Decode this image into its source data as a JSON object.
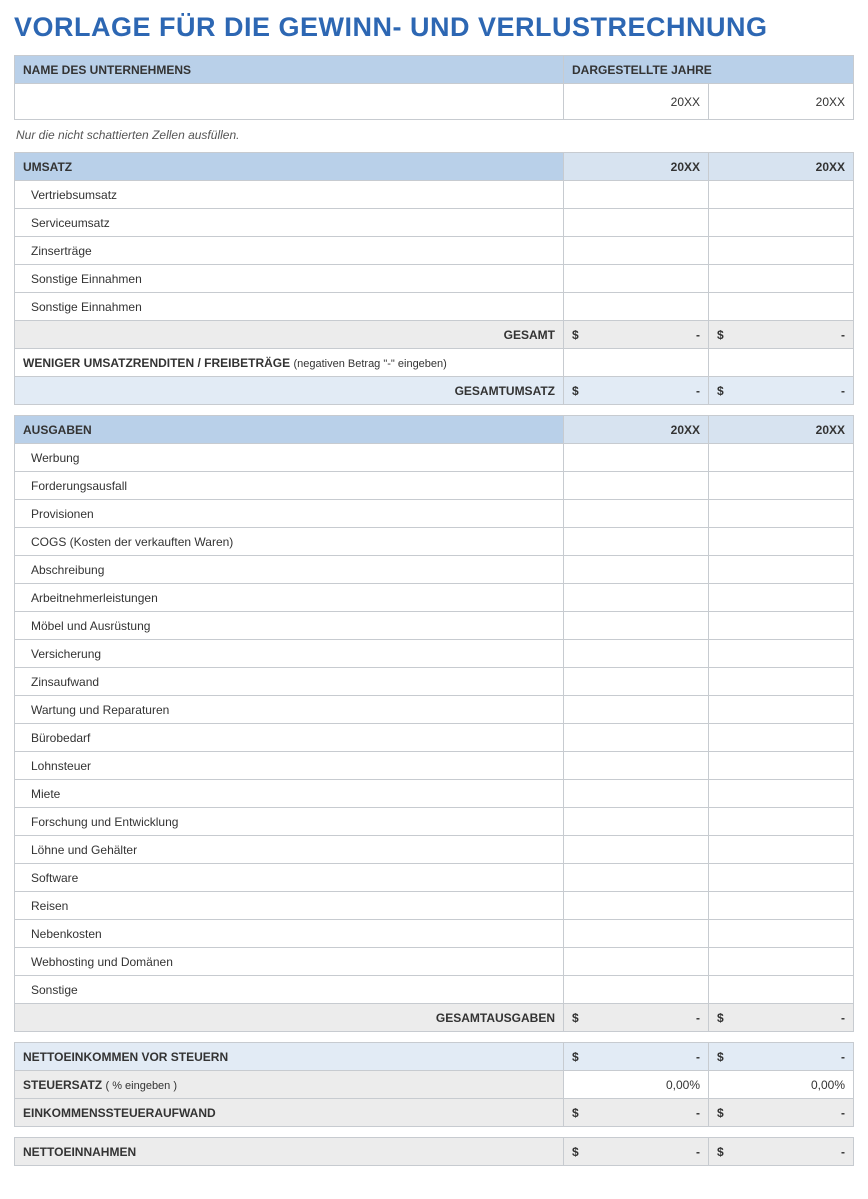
{
  "title": "VORLAGE FÜR DIE GEWINN- UND VERLUSTRECHNUNG",
  "company_header": {
    "name_label": "NAME DES UNTERNEHMENS",
    "years_label": "DARGESTELLTE JAHRE",
    "name_value": "",
    "year1": "20XX",
    "year2": "20XX"
  },
  "note": "Nur die nicht schattierten Zellen ausfüllen.",
  "revenue": {
    "header": "UMSATZ",
    "year1": "20XX",
    "year2": "20XX",
    "items": [
      "Vertriebsumsatz",
      "Serviceumsatz",
      "Zinserträge",
      "Sonstige Einnahmen",
      "Sonstige Einnahmen"
    ],
    "total_label": "GESAMT",
    "total_sym": "$",
    "total_val": "-",
    "less_label": "WENIGER UMSATZRENDITEN / FREIBETRÄGE",
    "less_note": "(negativen Betrag \"-\" eingeben)",
    "grand_label": "GESAMTUMSATZ",
    "grand_sym": "$",
    "grand_val": "-"
  },
  "expenses": {
    "header": "AUSGABEN",
    "year1": "20XX",
    "year2": "20XX",
    "items": [
      "Werbung",
      "Forderungsausfall",
      "Provisionen",
      "COGS (Kosten der verkauften Waren)",
      "Abschreibung",
      "Arbeitnehmerleistungen",
      "Möbel und Ausrüstung",
      "Versicherung",
      "Zinsaufwand",
      "Wartung und Reparaturen",
      "Bürobedarf",
      "Lohnsteuer",
      "Miete",
      "Forschung und Entwicklung",
      "Löhne und Gehälter",
      "Software",
      "Reisen",
      "Nebenkosten",
      "Webhosting und Domänen",
      "Sonstige"
    ],
    "total_label": "GESAMTAUSGABEN",
    "total_sym": "$",
    "total_val": "-"
  },
  "summary": {
    "pre_tax_label": "NETTOEINKOMMEN VOR STEUERN",
    "pre_tax_sym": "$",
    "pre_tax_val": "-",
    "tax_rate_label": "STEUERSATZ",
    "tax_rate_note": "( % eingeben )",
    "tax_rate_val1": "0,00%",
    "tax_rate_val2": "0,00%",
    "tax_expense_label": "EINKOMMENSSTEUERAUFWAND",
    "tax_expense_sym": "$",
    "tax_expense_val": "-",
    "net_label": "NETTOEINNAHMEN",
    "net_sym": "$",
    "net_val": "-"
  }
}
